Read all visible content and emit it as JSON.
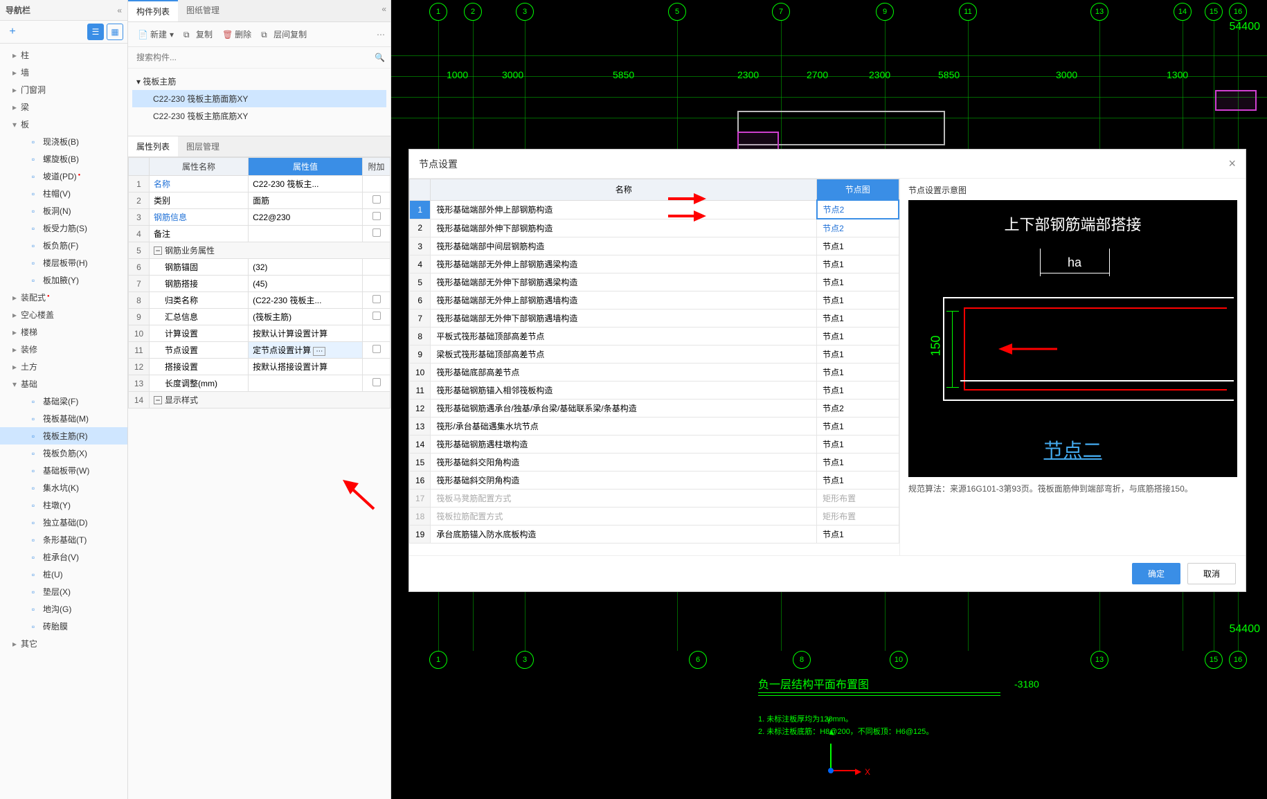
{
  "nav": {
    "title": "导航栏",
    "categories": [
      {
        "label": "柱"
      },
      {
        "label": "墙"
      },
      {
        "label": "门窗洞"
      },
      {
        "label": "梁"
      },
      {
        "label": "板",
        "expanded": true,
        "children": [
          {
            "label": "现浇板(B)",
            "icon": "slab"
          },
          {
            "label": "螺旋板(B)",
            "icon": "spiral"
          },
          {
            "label": "坡道(PD)",
            "icon": "ramp",
            "dot": true
          },
          {
            "label": "柱帽(V)",
            "icon": "cap"
          },
          {
            "label": "板洞(N)",
            "icon": "hole"
          },
          {
            "label": "板受力筋(S)",
            "icon": "rebarS"
          },
          {
            "label": "板负筋(F)",
            "icon": "rebarF"
          },
          {
            "label": "楼层板带(H)",
            "icon": "strip"
          },
          {
            "label": "板加腋(Y)",
            "icon": "haunch"
          }
        ]
      },
      {
        "label": "装配式",
        "dot": true
      },
      {
        "label": "空心楼盖"
      },
      {
        "label": "楼梯"
      },
      {
        "label": "装修"
      },
      {
        "label": "土方"
      },
      {
        "label": "基础",
        "expanded": true,
        "children": [
          {
            "label": "基础梁(F)",
            "icon": "fbeam"
          },
          {
            "label": "筏板基础(M)",
            "icon": "raft"
          },
          {
            "label": "筏板主筋(R)",
            "icon": "raftR",
            "selected": true
          },
          {
            "label": "筏板负筋(X)",
            "icon": "raftX"
          },
          {
            "label": "基础板带(W)",
            "icon": "fstrip"
          },
          {
            "label": "集水坑(K)",
            "icon": "pit"
          },
          {
            "label": "柱墩(Y)",
            "icon": "pier"
          },
          {
            "label": "独立基础(D)",
            "icon": "isolated"
          },
          {
            "label": "条形基础(T)",
            "icon": "stripF"
          },
          {
            "label": "桩承台(V)",
            "icon": "pilecap"
          },
          {
            "label": "桩(U)",
            "icon": "pile"
          },
          {
            "label": "垫层(X)",
            "icon": "bedding"
          },
          {
            "label": "地沟(G)",
            "icon": "trench"
          },
          {
            "label": "砖胎膜",
            "icon": "brick"
          }
        ]
      },
      {
        "label": "其它"
      }
    ]
  },
  "midPanel": {
    "tabs": {
      "components": "构件列表",
      "drawings": "图纸管理"
    },
    "toolbar": {
      "new": "新建",
      "copy": "复制",
      "delete": "删除",
      "layerCopy": "层间复制"
    },
    "searchPlaceholder": "搜索构件...",
    "tree": {
      "parent": "筏板主筋",
      "children": [
        {
          "label": "C22-230 筏板主筋面筋XY",
          "selected": true
        },
        {
          "label": "C22-230 筏板主筋底筋XY"
        }
      ]
    }
  },
  "propPanel": {
    "tabs": {
      "props": "属性列表",
      "layers": "图层管理"
    },
    "headers": {
      "name": "属性名称",
      "value": "属性值",
      "extra": "附加"
    },
    "rows": [
      {
        "n": "1",
        "name": "名称",
        "value": "C22-230 筏板主...",
        "link": true
      },
      {
        "n": "2",
        "name": "类别",
        "value": "面筋",
        "chk": true
      },
      {
        "n": "3",
        "name": "钢筋信息",
        "value": "C22@230",
        "link": true,
        "chk": true
      },
      {
        "n": "4",
        "name": "备注",
        "value": "",
        "chk": true
      },
      {
        "n": "5",
        "name": "钢筋业务属性",
        "group": true
      },
      {
        "n": "6",
        "name": "钢筋锚固",
        "value": "(32)",
        "indent": true
      },
      {
        "n": "7",
        "name": "钢筋搭接",
        "value": "(45)",
        "indent": true
      },
      {
        "n": "8",
        "name": "归类名称",
        "value": "(C22-230 筏板主...",
        "indent": true,
        "chk": true
      },
      {
        "n": "9",
        "name": "汇总信息",
        "value": "(筏板主筋)",
        "indent": true,
        "chk": true
      },
      {
        "n": "10",
        "name": "计算设置",
        "value": "按默认计算设置计算",
        "indent": true
      },
      {
        "n": "11",
        "name": "节点设置",
        "value": "定节点设置计算",
        "indent": true,
        "highlight": true,
        "chk": true
      },
      {
        "n": "12",
        "name": "搭接设置",
        "value": "按默认搭接设置计算",
        "indent": true
      },
      {
        "n": "13",
        "name": "长度调整(mm)",
        "value": "",
        "indent": true,
        "chk": true
      },
      {
        "n": "14",
        "name": "显示样式",
        "group": true
      }
    ]
  },
  "canvas": {
    "coord": "54400",
    "coordBot": "54400",
    "bubbles": [
      "1",
      "2",
      "3",
      "5",
      "7",
      "9",
      "11",
      "13",
      "14",
      "15",
      "16"
    ],
    "bottomBubbles": [
      "1",
      "3",
      "6",
      "8",
      "10",
      "13",
      "15",
      "16"
    ],
    "dims": [
      "1000",
      "3000",
      "5850",
      "2300",
      "2700",
      "2300",
      "5850",
      "3000",
      "1300"
    ],
    "title": "负一层结构平面布置图",
    "dimMinus": "-3180",
    "notes": [
      "1. 未标注板厚均为120mm。",
      "2. 未标注板底筋：H8@200，不同板顶：H6@125。"
    ]
  },
  "dialog": {
    "title": "节点设置",
    "headers": {
      "name": "名称",
      "pic": "节点图"
    },
    "rows": [
      {
        "n": "1",
        "name": "筏形基础端部外伸上部钢筋构造",
        "pic": "节点2",
        "sel": true,
        "linkPic": true
      },
      {
        "n": "2",
        "name": "筏形基础端部外伸下部钢筋构造",
        "pic": "节点2",
        "linkPic": true
      },
      {
        "n": "3",
        "name": "筏形基础端部中间层钢筋构造",
        "pic": "节点1"
      },
      {
        "n": "4",
        "name": "筏形基础端部无外伸上部钢筋遇梁构造",
        "pic": "节点1"
      },
      {
        "n": "5",
        "name": "筏形基础端部无外伸下部钢筋遇梁构造",
        "pic": "节点1"
      },
      {
        "n": "6",
        "name": "筏形基础端部无外伸上部钢筋遇墙构造",
        "pic": "节点1"
      },
      {
        "n": "7",
        "name": "筏形基础端部无外伸下部钢筋遇墙构造",
        "pic": "节点1"
      },
      {
        "n": "8",
        "name": "平板式筏形基础顶部高差节点",
        "pic": "节点1"
      },
      {
        "n": "9",
        "name": "梁板式筏形基础顶部高差节点",
        "pic": "节点1"
      },
      {
        "n": "10",
        "name": "筏形基础底部高差节点",
        "pic": "节点1"
      },
      {
        "n": "11",
        "name": "筏形基础钢筋锚入相邻筏板构造",
        "pic": "节点1"
      },
      {
        "n": "12",
        "name": "筏形基础钢筋遇承台/独基/承台梁/基础联系梁/条基构造",
        "pic": "节点2"
      },
      {
        "n": "13",
        "name": "筏形/承台基础遇集水坑节点",
        "pic": "节点1"
      },
      {
        "n": "14",
        "name": "筏形基础钢筋遇柱墩构造",
        "pic": "节点1"
      },
      {
        "n": "15",
        "name": "筏形基础斜交阳角构造",
        "pic": "节点1"
      },
      {
        "n": "16",
        "name": "筏形基础斜交阴角构造",
        "pic": "节点1"
      },
      {
        "n": "17",
        "name": "筏板马凳筋配置方式",
        "pic": "矩形布置",
        "disabled": true
      },
      {
        "n": "18",
        "name": "筏板拉筋配置方式",
        "pic": "矩形布置",
        "disabled": true
      },
      {
        "n": "19",
        "name": "承台底筋锚入防水底板构造",
        "pic": "节点1"
      }
    ],
    "previewTitle": "节点设置示意图",
    "previewCaption": "上下部钢筋端部搭接",
    "previewHa": "ha",
    "previewDim": "150",
    "previewNodeLabel": "节点二",
    "algoNote": "规范算法：来源16G101-3第93页。筏板面筋伸到端部弯折，与底筋搭接150。",
    "buttons": {
      "ok": "确定",
      "cancel": "取消"
    }
  }
}
